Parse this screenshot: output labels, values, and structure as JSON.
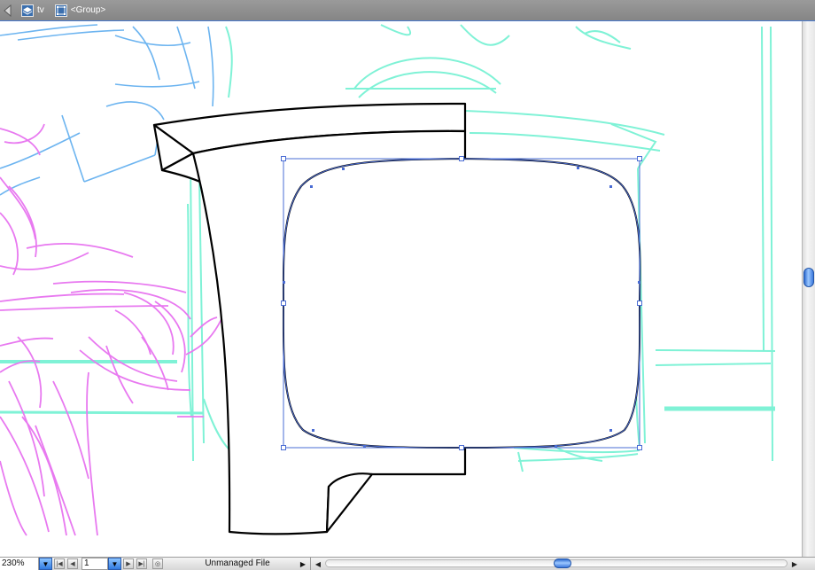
{
  "breadcrumb": {
    "back_icon": "back-arrow-icon",
    "layer_icon": "layer-icon",
    "layer_label": "tv",
    "group_icon": "group-icon",
    "group_label": "<Group>"
  },
  "status_bar": {
    "zoom_value": "230%",
    "page_value": "1",
    "status_text": "Unmanaged File"
  },
  "colors": {
    "topbar": "#8f8f8f",
    "selection": "#4a6cd4",
    "sketch_pink": "#e879f0",
    "sketch_blue": "#6cb4f0",
    "sketch_green": "#7ff2d6",
    "outline": "#000000"
  }
}
